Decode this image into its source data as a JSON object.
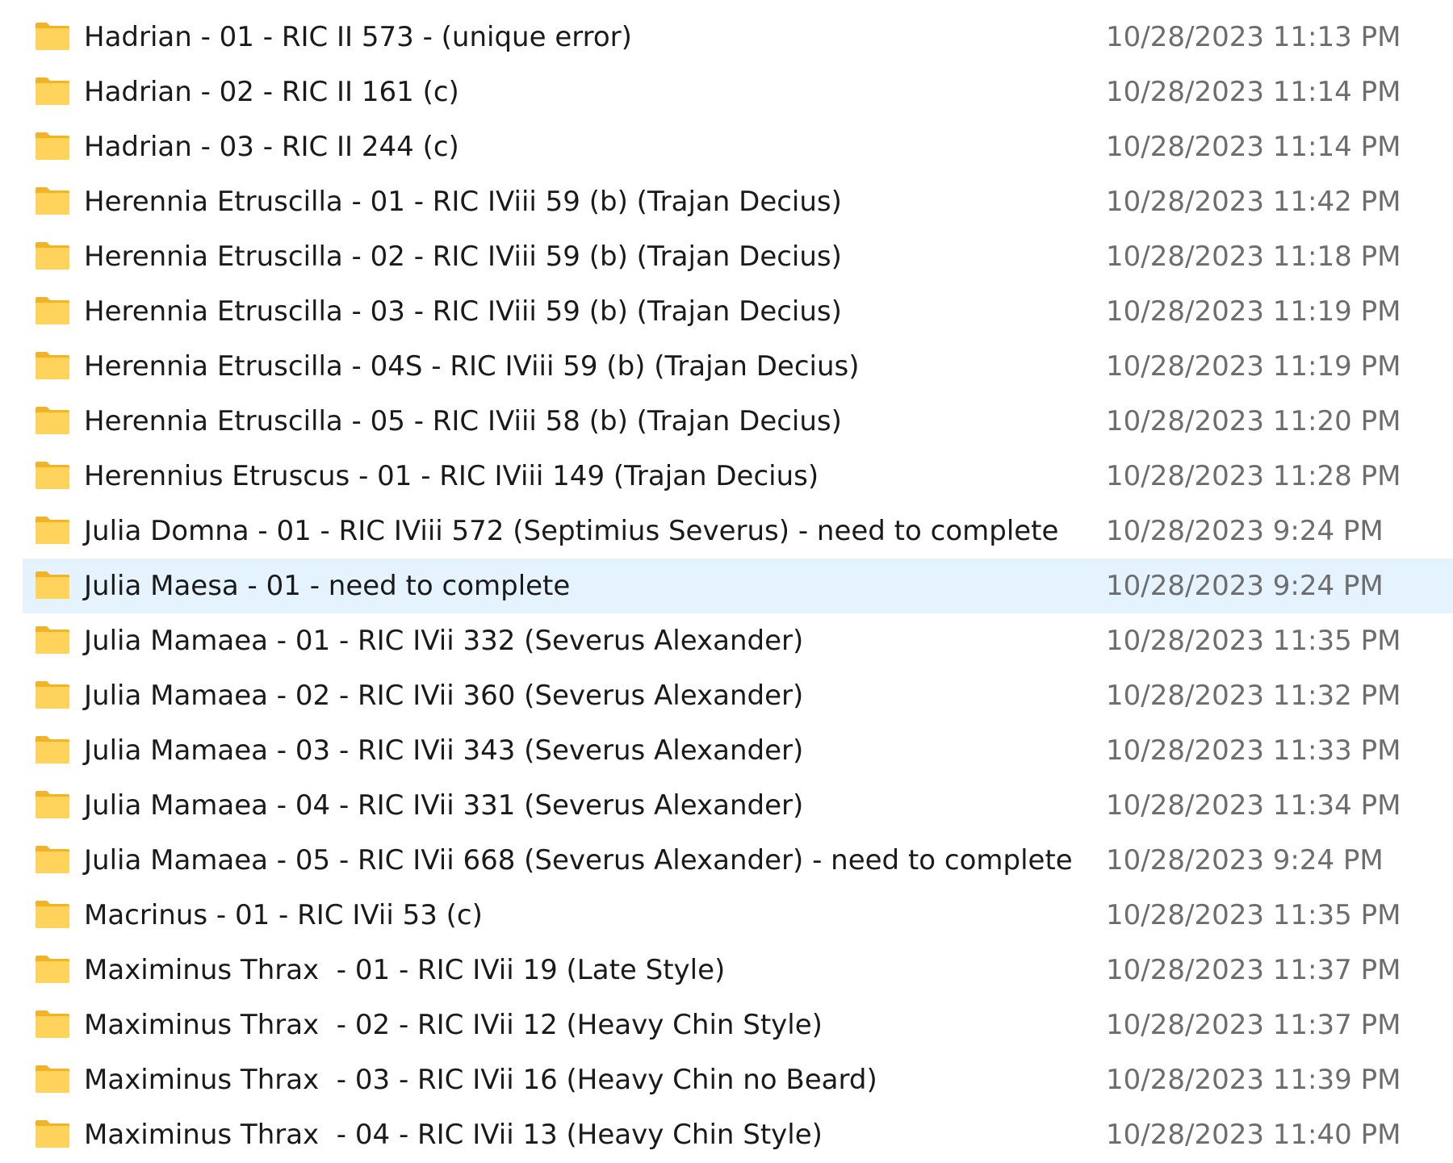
{
  "colors": {
    "folder_front": "#ffd35c",
    "folder_back": "#f0b429",
    "selected_row_bg": "#e5f3ff",
    "date_text": "#6d6d6d",
    "name_text": "#1a1a1a"
  },
  "icons": {
    "folder": "folder-icon"
  },
  "files": [
    {
      "name": "Hadrian - 01 - RIC II 573 - (unique error)",
      "date": "10/28/2023 11:13 PM",
      "selected": false
    },
    {
      "name": "Hadrian - 02 - RIC II 161 (c)",
      "date": "10/28/2023 11:14 PM",
      "selected": false
    },
    {
      "name": "Hadrian - 03 - RIC II 244 (c)",
      "date": "10/28/2023 11:14 PM",
      "selected": false
    },
    {
      "name": "Herennia Etruscilla - 01 - RIC IViii 59 (b) (Trajan Decius)",
      "date": "10/28/2023 11:42 PM",
      "selected": false
    },
    {
      "name": "Herennia Etruscilla - 02 - RIC IViii 59 (b) (Trajan Decius)",
      "date": "10/28/2023 11:18 PM",
      "selected": false
    },
    {
      "name": "Herennia Etruscilla - 03 - RIC IViii 59 (b) (Trajan Decius)",
      "date": "10/28/2023 11:19 PM",
      "selected": false
    },
    {
      "name": "Herennia Etruscilla - 04S - RIC IViii 59 (b) (Trajan Decius)",
      "date": "10/28/2023 11:19 PM",
      "selected": false
    },
    {
      "name": "Herennia Etruscilla - 05 - RIC IViii 58 (b) (Trajan Decius)",
      "date": "10/28/2023 11:20 PM",
      "selected": false
    },
    {
      "name": "Herennius Etruscus - 01 - RIC IViii 149 (Trajan Decius)",
      "date": "10/28/2023 11:28 PM",
      "selected": false
    },
    {
      "name": "Julia Domna - 01 - RIC IViii 572 (Septimius Severus) - need to complete",
      "date": "10/28/2023 9:24 PM",
      "selected": false
    },
    {
      "name": "Julia Maesa - 01 - need to complete",
      "date": "10/28/2023 9:24 PM",
      "selected": true
    },
    {
      "name": "Julia Mamaea - 01 - RIC IVii 332 (Severus Alexander)",
      "date": "10/28/2023 11:35 PM",
      "selected": false
    },
    {
      "name": "Julia Mamaea - 02 - RIC IVii 360 (Severus Alexander)",
      "date": "10/28/2023 11:32 PM",
      "selected": false
    },
    {
      "name": "Julia Mamaea - 03 - RIC IVii 343 (Severus Alexander)",
      "date": "10/28/2023 11:33 PM",
      "selected": false
    },
    {
      "name": "Julia Mamaea - 04 - RIC IVii 331 (Severus Alexander)",
      "date": "10/28/2023 11:34 PM",
      "selected": false
    },
    {
      "name": "Julia Mamaea - 05 - RIC IVii 668 (Severus Alexander) - need to complete",
      "date": "10/28/2023 9:24 PM",
      "selected": false
    },
    {
      "name": "Macrinus - 01 - RIC IVii 53 (c)",
      "date": "10/28/2023 11:35 PM",
      "selected": false
    },
    {
      "name": "Maximinus Thrax  - 01 - RIC IVii 19 (Late Style)",
      "date": "10/28/2023 11:37 PM",
      "selected": false
    },
    {
      "name": "Maximinus Thrax  - 02 - RIC IVii 12 (Heavy Chin Style)",
      "date": "10/28/2023 11:37 PM",
      "selected": false
    },
    {
      "name": "Maximinus Thrax  - 03 - RIC IVii 16 (Heavy Chin no Beard)",
      "date": "10/28/2023 11:39 PM",
      "selected": false
    },
    {
      "name": "Maximinus Thrax  - 04 - RIC IVii 13 (Heavy Chin Style)",
      "date": "10/28/2023 11:40 PM",
      "selected": false
    }
  ]
}
